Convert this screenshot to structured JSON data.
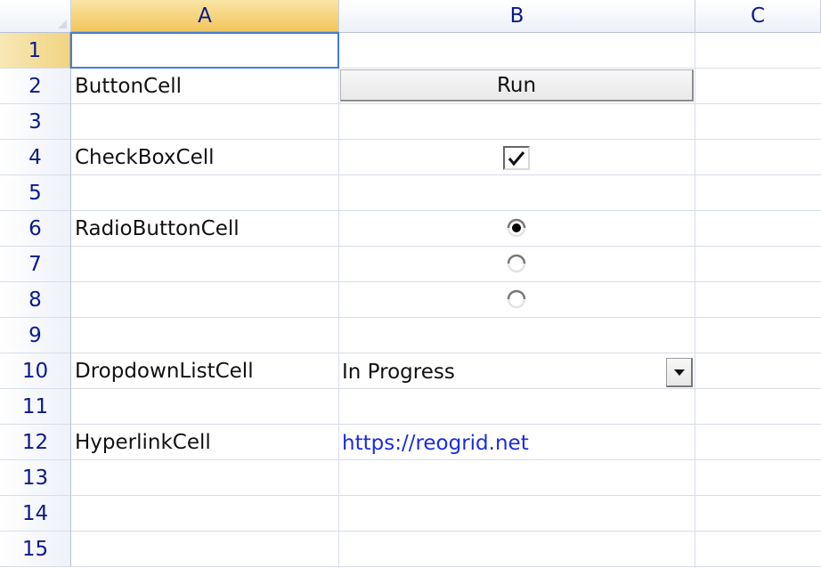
{
  "columns": [
    "A",
    "B",
    "C"
  ],
  "rows": [
    "1",
    "2",
    "3",
    "4",
    "5",
    "6",
    "7",
    "8",
    "9",
    "10",
    "11",
    "12",
    "13",
    "14",
    "15"
  ],
  "cells": {
    "a2": "ButtonCell",
    "a4": "CheckBoxCell",
    "a6": "RadioButtonCell",
    "a10": "DropdownListCell",
    "a12": "HyperlinkCell"
  },
  "button": {
    "label": "Run"
  },
  "checkbox": {
    "checked": true
  },
  "radios": [
    {
      "row": "6",
      "checked": true
    },
    {
      "row": "7",
      "checked": false
    },
    {
      "row": "8",
      "checked": false
    }
  ],
  "dropdown": {
    "value": "In Progress"
  },
  "hyperlink": {
    "text": "https://reogrid.net"
  },
  "colors": {
    "header_text": "#0a1a8c",
    "selection": "#3f7fd9",
    "active_header": "#f2c65c",
    "link": "#1a2ce0"
  },
  "icons": [
    "corner-select-icon",
    "checkmark-icon",
    "radio-dot-icon",
    "dropdown-arrow-icon"
  ]
}
